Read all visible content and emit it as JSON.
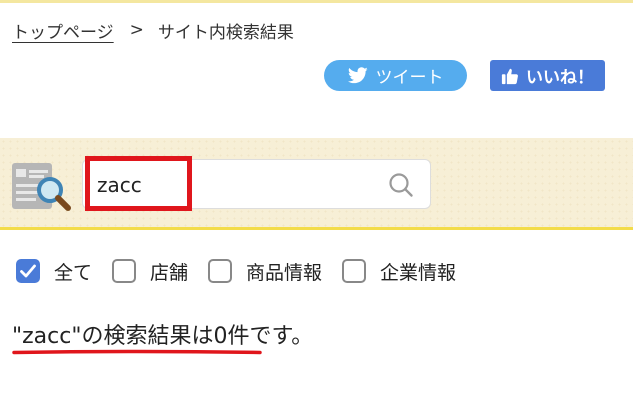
{
  "breadcrumb": {
    "home": "トップページ",
    "separator": ">",
    "current": "サイト内検索結果"
  },
  "social": {
    "tweet_label": "ツイート",
    "like_label": "いいね！",
    "tweet_color": "#55acee",
    "like_color": "#4a7bd8"
  },
  "search": {
    "value": "zacc",
    "placeholder": "",
    "icon": "search-icon"
  },
  "filters": [
    {
      "label": "全て",
      "checked": true
    },
    {
      "label": "店舗",
      "checked": false
    },
    {
      "label": "商品情報",
      "checked": false
    },
    {
      "label": "企業情報",
      "checked": false
    }
  ],
  "result": {
    "text": "\"zacc\"の検索結果は0件です。"
  },
  "colors": {
    "band_bg": "#f7efd6",
    "band_border": "#f3dc4a",
    "highlight": "#e0161c",
    "checkbox_checked": "#4a7bd8"
  }
}
